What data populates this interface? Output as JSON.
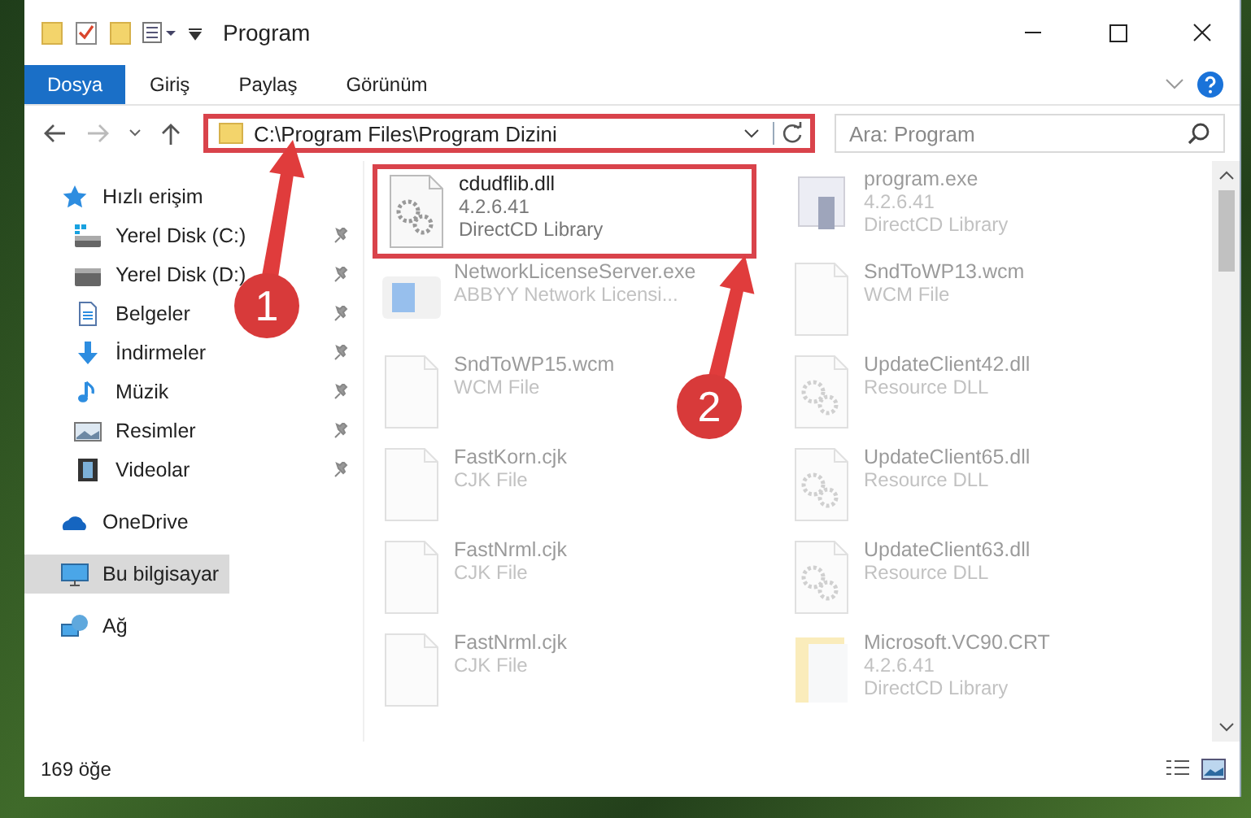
{
  "window": {
    "title": "Program"
  },
  "ribbon_tabs": [
    {
      "label": "Dosya",
      "selected": true
    },
    {
      "label": "Giriş",
      "selected": false
    },
    {
      "label": "Paylaş",
      "selected": false
    },
    {
      "label": "Görünüm",
      "selected": false
    }
  ],
  "address_bar": {
    "path": "C:\\Program Files\\Program Dizini",
    "highlighted": true
  },
  "search": {
    "placeholder": "Ara: Program"
  },
  "sidebar": {
    "items": [
      {
        "label": "Hızlı erişim",
        "kind": "star",
        "pinned": false,
        "selected": false,
        "group": true
      },
      {
        "label": "Yerel Disk (C:)",
        "kind": "drive-c",
        "pinned": true,
        "selected": false,
        "group": false
      },
      {
        "label": "Yerel Disk (D:)",
        "kind": "drive",
        "pinned": true,
        "selected": false,
        "group": false
      },
      {
        "label": "Belgeler",
        "kind": "document",
        "pinned": true,
        "selected": false,
        "group": false
      },
      {
        "label": "İndirmeler",
        "kind": "download",
        "pinned": true,
        "selected": false,
        "group": false
      },
      {
        "label": "Müzik",
        "kind": "music",
        "pinned": true,
        "selected": false,
        "group": false
      },
      {
        "label": "Resimler",
        "kind": "picture",
        "pinned": true,
        "selected": false,
        "group": false
      },
      {
        "label": "Videolar",
        "kind": "video",
        "pinned": true,
        "selected": false,
        "group": false
      },
      {
        "label": "OneDrive",
        "kind": "cloud",
        "pinned": false,
        "selected": false,
        "group": true
      },
      {
        "label": "Bu bilgisayar",
        "kind": "computer",
        "pinned": false,
        "selected": true,
        "group": true
      },
      {
        "label": "Ağ",
        "kind": "network",
        "pinned": false,
        "selected": false,
        "group": true
      }
    ]
  },
  "files": [
    {
      "name": "cdudflib.dll",
      "details": [
        "4.2.6.41",
        "DirectCD Library"
      ],
      "kind": "dll",
      "highlighted": true
    },
    {
      "name": "program.exe",
      "details": [
        "4.2.6.41",
        "DirectCD Library"
      ],
      "kind": "exe",
      "highlighted": false
    },
    {
      "name": "NetworkLicenseServer.exe",
      "details": [
        "ABBYY Network Licensi..."
      ],
      "kind": "app",
      "highlighted": false
    },
    {
      "name": "SndToWP13.wcm",
      "details": [
        "WCM File"
      ],
      "kind": "file",
      "highlighted": false
    },
    {
      "name": "SndToWP15.wcm",
      "details": [
        "WCM File"
      ],
      "kind": "file",
      "highlighted": false
    },
    {
      "name": "UpdateClient42.dll",
      "details": [
        "Resource DLL"
      ],
      "kind": "dll",
      "highlighted": false
    },
    {
      "name": "FastKorn.cjk",
      "details": [
        "CJK File"
      ],
      "kind": "file",
      "highlighted": false
    },
    {
      "name": "UpdateClient65.dll",
      "details": [
        "Resource DLL"
      ],
      "kind": "dll",
      "highlighted": false
    },
    {
      "name": "FastNrml.cjk",
      "details": [
        "CJK File"
      ],
      "kind": "file",
      "highlighted": false
    },
    {
      "name": "UpdateClient63.dll",
      "details": [
        "Resource DLL"
      ],
      "kind": "dll",
      "highlighted": false
    },
    {
      "name": "FastNrml.cjk",
      "details": [
        "CJK File"
      ],
      "kind": "file",
      "highlighted": false
    },
    {
      "name": "Microsoft.VC90.CRT",
      "details": [
        "4.2.6.41",
        "DirectCD Library"
      ],
      "kind": "folder",
      "highlighted": false
    }
  ],
  "status_bar": {
    "count": "169 öğe"
  },
  "annotations": [
    {
      "label": "1"
    },
    {
      "label": "2"
    }
  ]
}
